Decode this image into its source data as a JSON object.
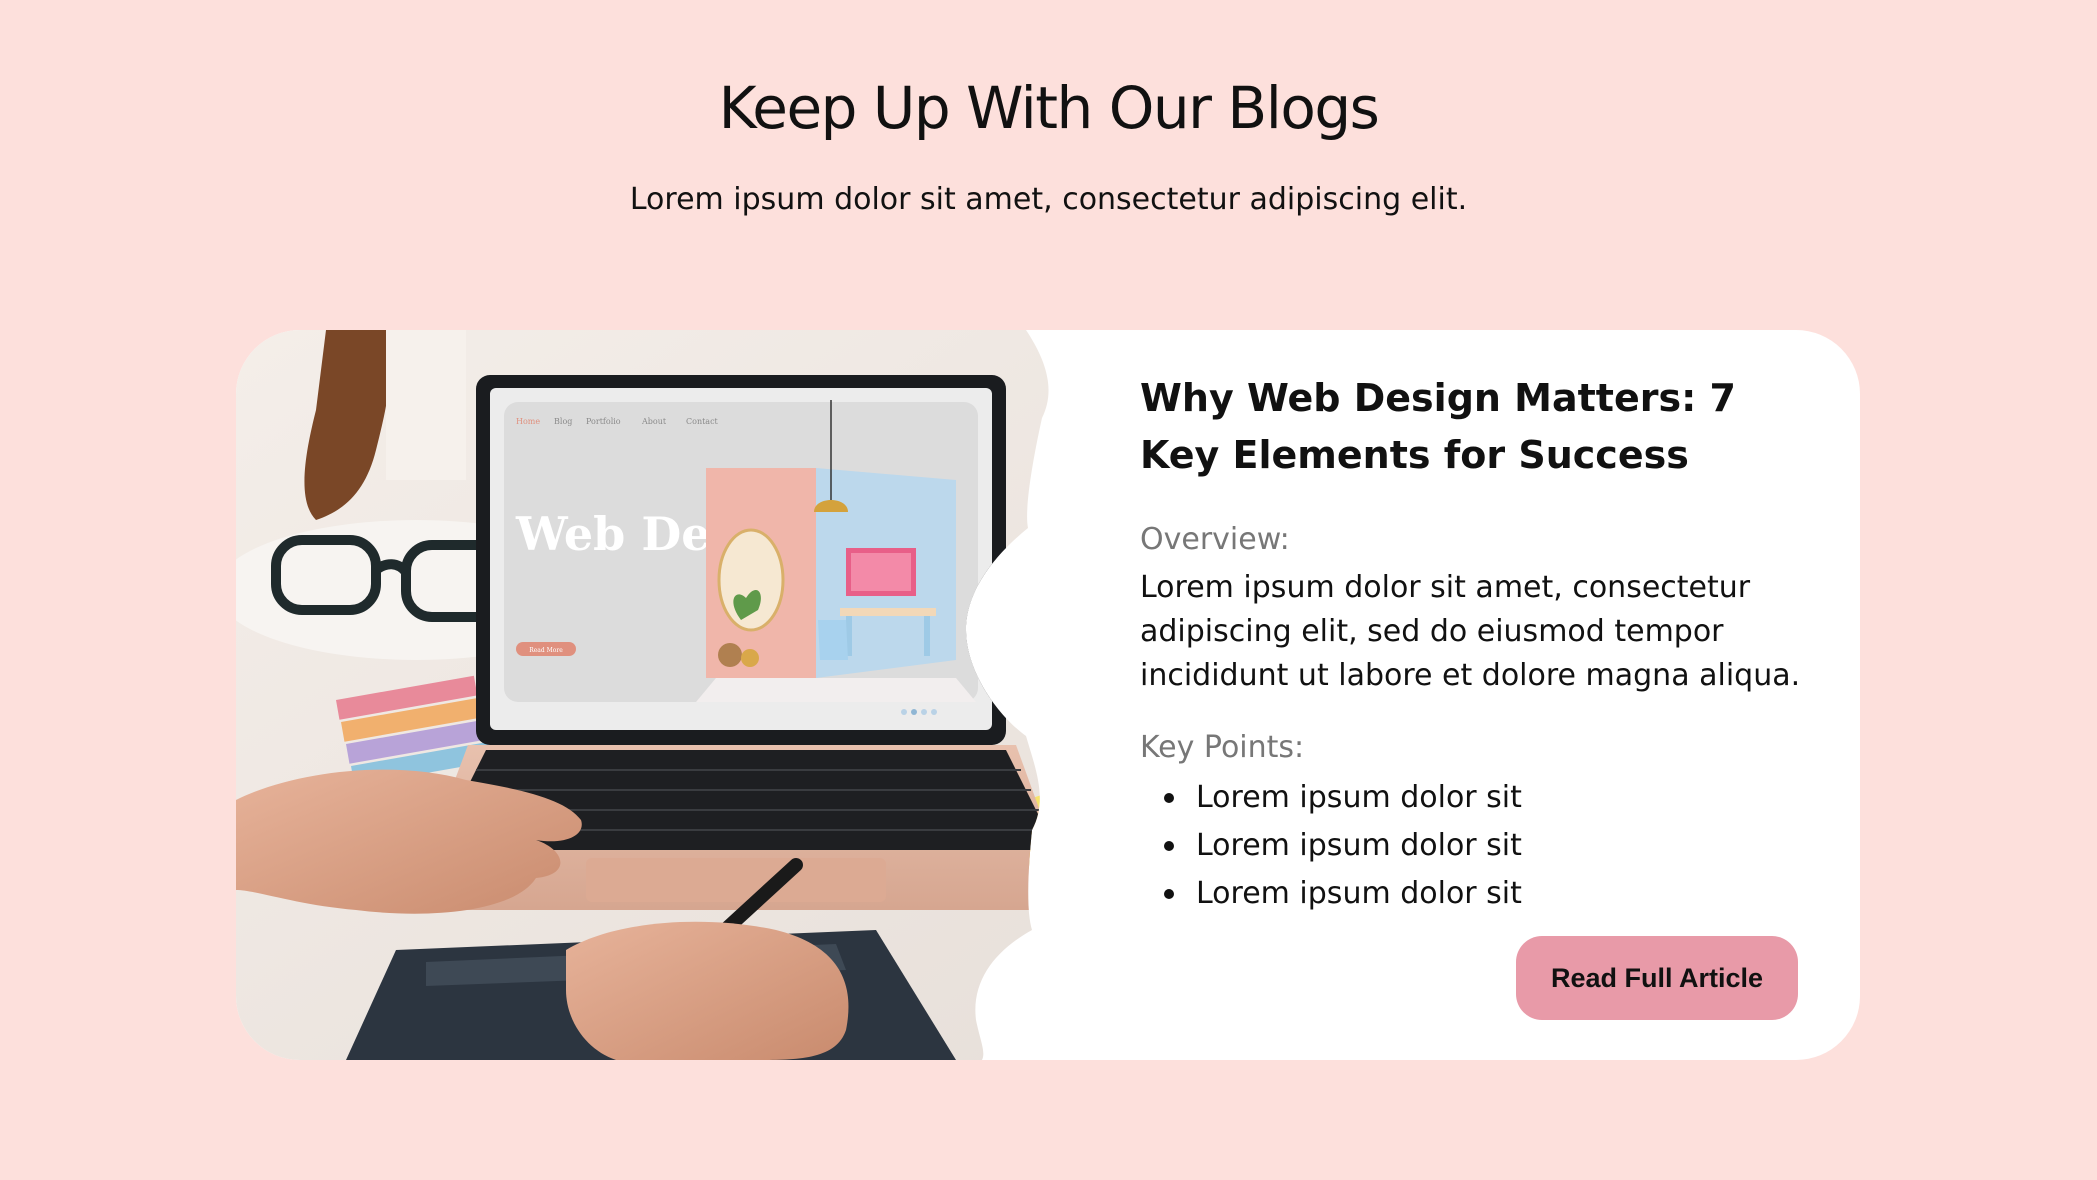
{
  "header": {
    "title": "Keep Up With Our Blogs",
    "subtitle": "Lorem ipsum dolor sit amet, consectetur adipiscing elit."
  },
  "article": {
    "title": "Why Web Design Matters: 7 Key Elements for Success",
    "overview_label": "Overview:",
    "overview_text": "Lorem ipsum dolor sit amet, consectetur adipiscing elit, sed do eiusmod tempor incididunt ut labore et dolore magna aliqua.",
    "key_points_label": "Key Points:",
    "key_points": [
      "Lorem ipsum dolor sit",
      "Lorem ipsum dolor sit",
      "Lorem ipsum dolor sit"
    ],
    "button_label": "Read Full Article"
  },
  "image": {
    "screen_title": "Web Design.",
    "screen_nav": [
      "Home",
      "Blog",
      "Portfolio",
      "About",
      "Contact"
    ],
    "screen_button": "Read More"
  },
  "colors": {
    "page_background": "#fde0dc",
    "card_background": "#ffffff",
    "button": "#e89aa8"
  }
}
